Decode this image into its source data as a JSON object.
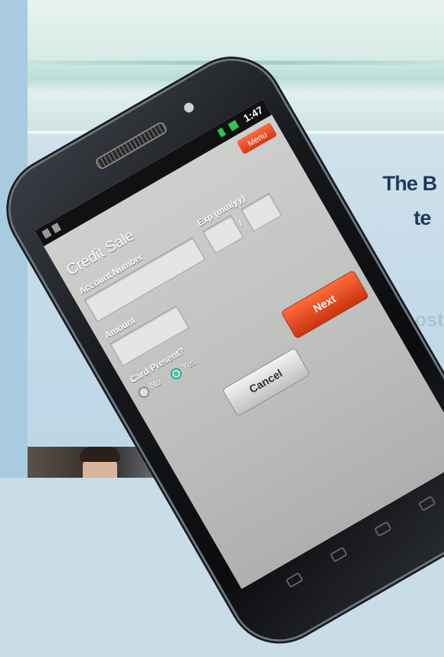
{
  "app": {
    "title": "Credit Sale",
    "menu_label": "Menu",
    "status_time": "1:47"
  },
  "form": {
    "account_label": "Account Number",
    "account_value": "",
    "exp_label": "Exp (mm/yy)",
    "exp_month_value": "",
    "exp_year_value": "",
    "exp_separator": "/",
    "amount_label": "Amount",
    "amount_value": "",
    "card_present_label": "Card Present?",
    "option_no": "No",
    "option_yes": "Yes",
    "selected_option": "Yes"
  },
  "buttons": {
    "next": "Next",
    "cancel": "Cancel"
  },
  "article": {
    "headline_line1": "The B",
    "headline_line2": "te",
    "faded_word": "costs"
  },
  "colors": {
    "accent_orange": "#e0461c",
    "radio_teal": "#2fd0b4",
    "headline_navy": "#1f3b57"
  }
}
